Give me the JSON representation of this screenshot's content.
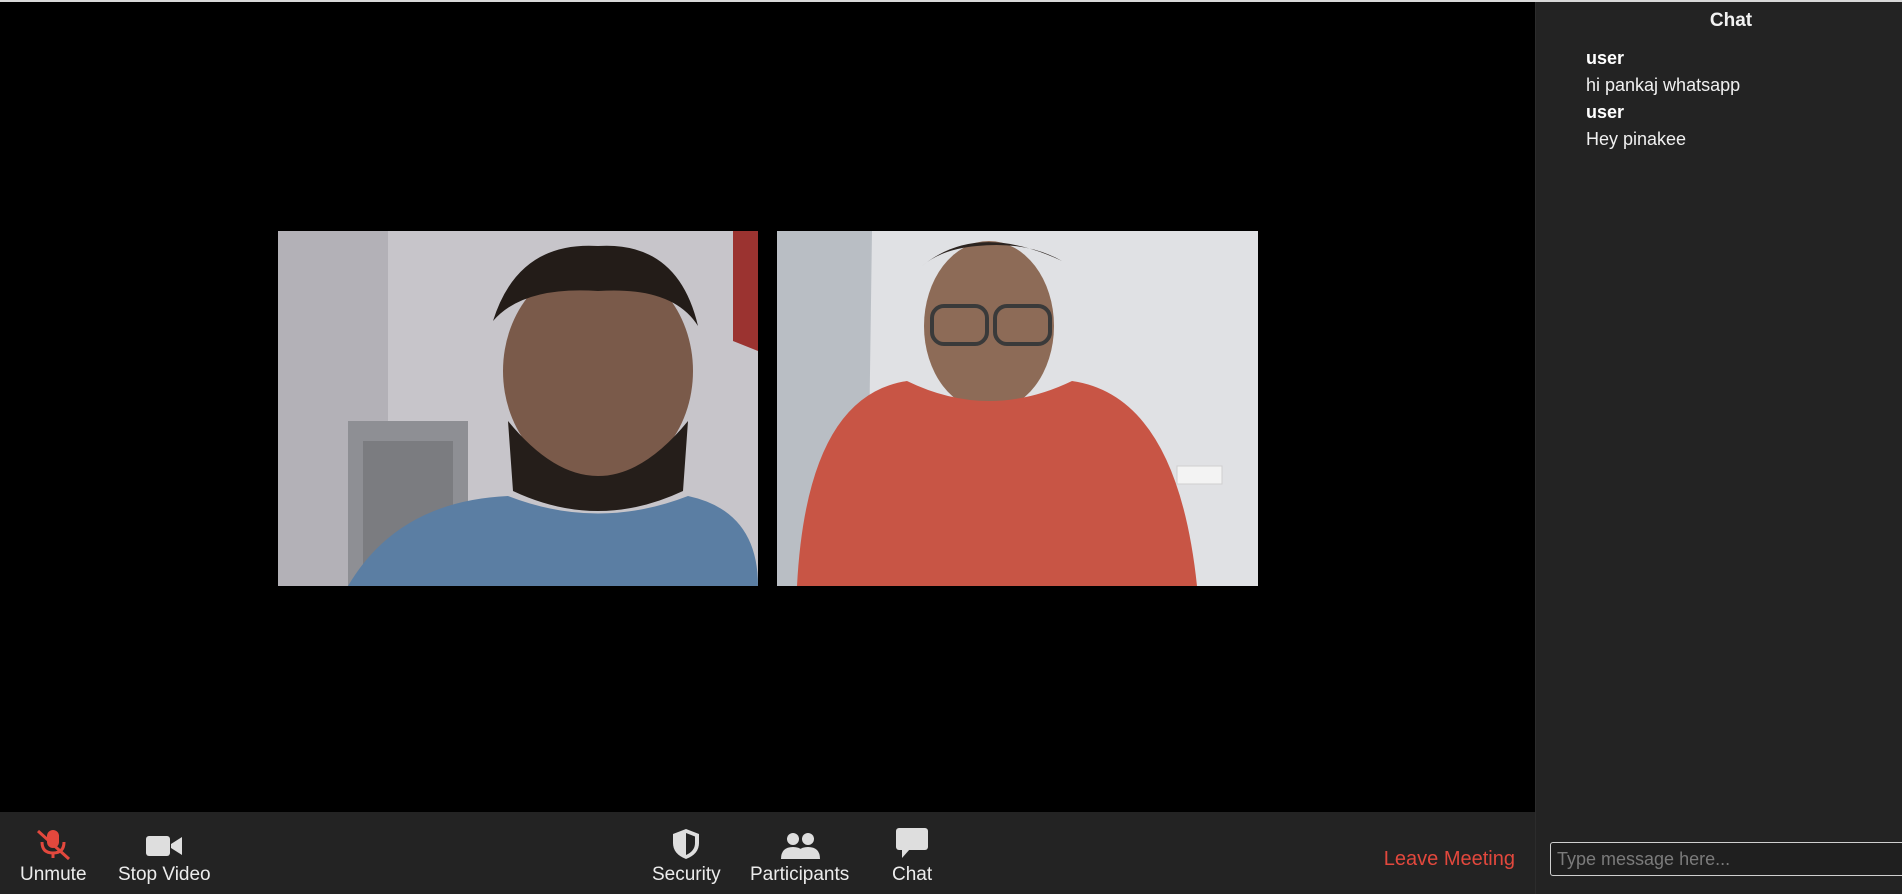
{
  "controls": {
    "unmute_label": "Unmute",
    "stop_video_label": "Stop Video",
    "security_label": "Security",
    "participants_label": "Participants",
    "chat_label": "Chat",
    "leave_label": "Leave Meeting"
  },
  "chat": {
    "title": "Chat",
    "messages": [
      {
        "user": "user",
        "text": "hi pankaj whatsapp"
      },
      {
        "user": "user",
        "text": "Hey pinakee"
      }
    ],
    "input_placeholder": "Type message here..."
  },
  "colors": {
    "leave": "#e2483d",
    "mute_icon": "#e2483d",
    "panel_bg": "#232323",
    "stage_bg": "#000000"
  }
}
